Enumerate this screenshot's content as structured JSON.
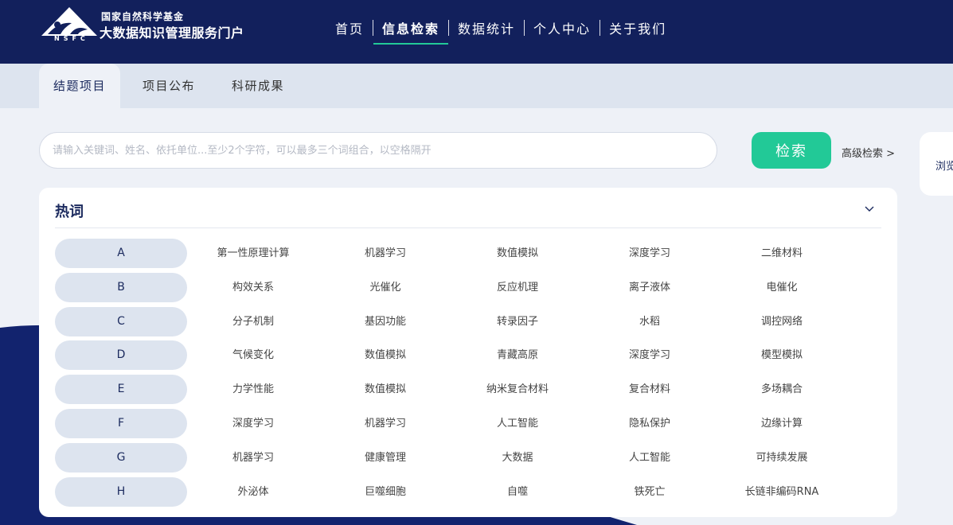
{
  "header": {
    "logo_sub": "NSFC",
    "brand_line1": "国家自然科学基金",
    "brand_line2": "大数据知识管理服务门户",
    "nav": [
      {
        "label": "首页"
      },
      {
        "label": "信息检索"
      },
      {
        "label": "数据统计"
      },
      {
        "label": "个人中心"
      },
      {
        "label": "关于我们"
      }
    ],
    "active_nav": "信息检索"
  },
  "tabs": [
    {
      "label": "结题项目"
    },
    {
      "label": "项目公布"
    },
    {
      "label": "科研成果"
    }
  ],
  "active_tab": "结题项目",
  "search": {
    "placeholder": "请输入关键词、姓名、依托单位...至少2个字符，可以最多三个词组合，以空格隔开",
    "value": "",
    "button_label": "检索",
    "advanced_label": "高级检索 >"
  },
  "side_card": {
    "label": "浏览"
  },
  "hot": {
    "title": "热词",
    "toggle_icon": "chevron-down-icon",
    "rows": [
      {
        "letter": "A",
        "words": [
          "第一性原理计算",
          "机器学习",
          "数值模拟",
          "深度学习",
          "二维材料"
        ]
      },
      {
        "letter": "B",
        "words": [
          "构效关系",
          "光催化",
          "反应机理",
          "离子液体",
          "电催化"
        ]
      },
      {
        "letter": "C",
        "words": [
          "分子机制",
          "基因功能",
          "转录因子",
          "水稻",
          "调控网络"
        ]
      },
      {
        "letter": "D",
        "words": [
          "气候变化",
          "数值模拟",
          "青藏高原",
          "深度学习",
          "模型模拟"
        ]
      },
      {
        "letter": "E",
        "words": [
          "力学性能",
          "数值模拟",
          "纳米复合材料",
          "复合材料",
          "多场耦合"
        ]
      },
      {
        "letter": "F",
        "words": [
          "深度学习",
          "机器学习",
          "人工智能",
          "隐私保护",
          "边缘计算"
        ]
      },
      {
        "letter": "G",
        "words": [
          "机器学习",
          "健康管理",
          "大数据",
          "人工智能",
          "可持续发展"
        ]
      },
      {
        "letter": "H",
        "words": [
          "外泌体",
          "巨噬细胞",
          "自噬",
          "铁死亡",
          "长链非编码RNA"
        ]
      }
    ]
  },
  "colors": {
    "header_bg": "#12205c",
    "accent": "#22c997",
    "page_bg": "#eef1f7",
    "tabbar_bg": "#dde4ef",
    "pill_bg": "#dde4ef",
    "title_text": "#1b2a5e"
  }
}
